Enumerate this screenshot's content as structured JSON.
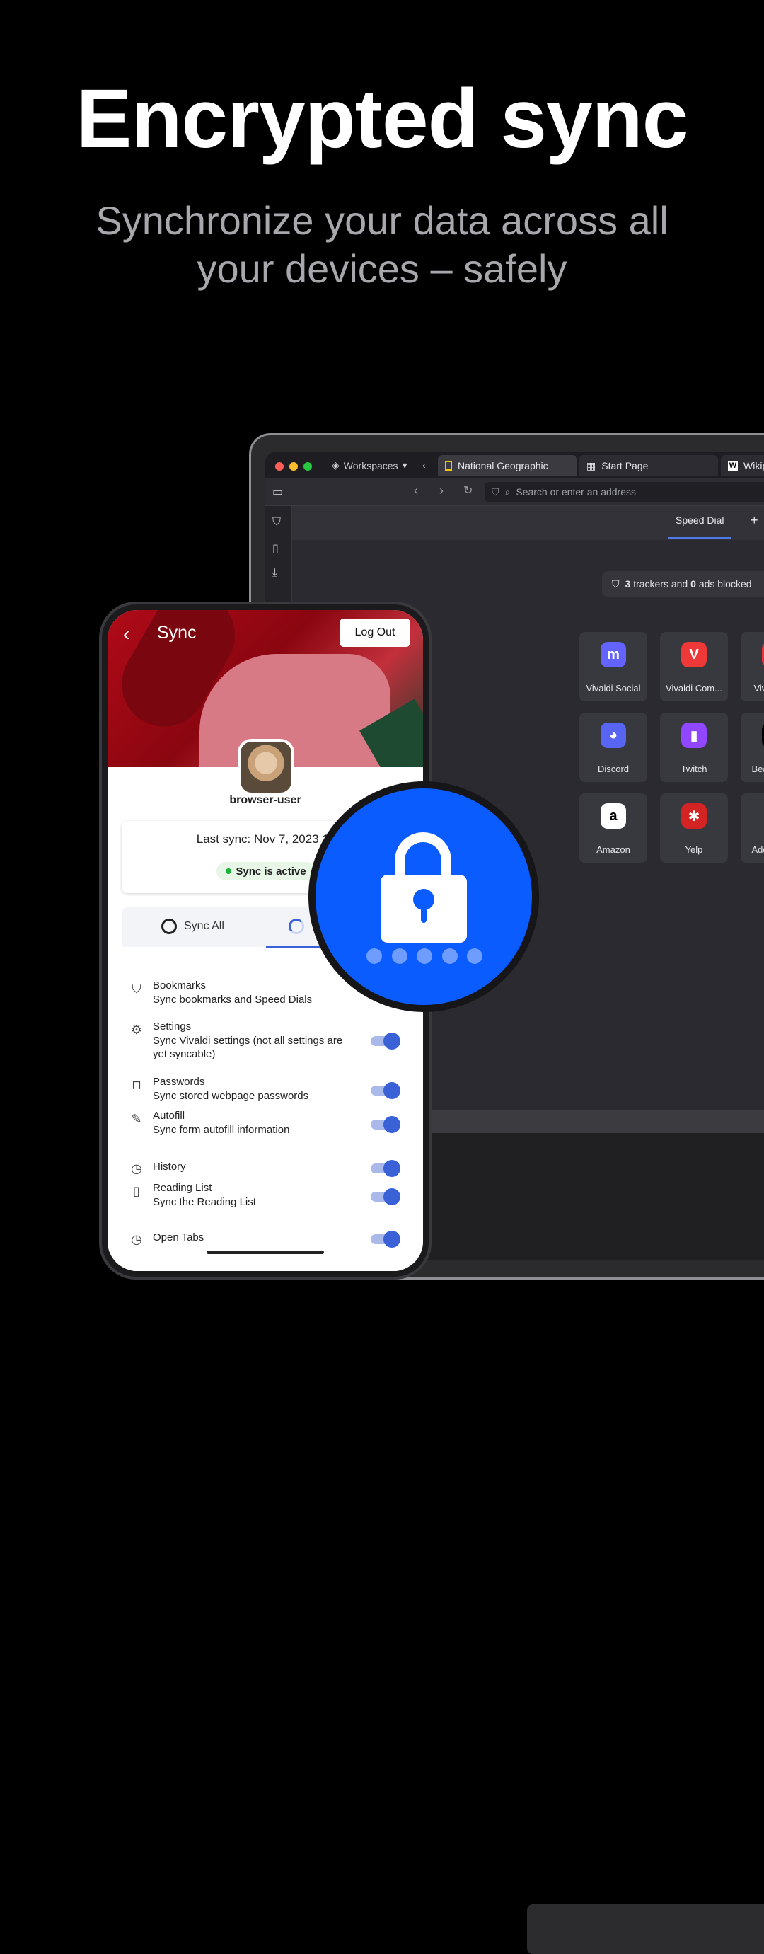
{
  "headline": "Encrypted sync",
  "subheadline": "Synchronize your data across all your devices – safely",
  "laptop": {
    "workspaces": "Workspaces",
    "tabs": [
      "National Geographic",
      "Start Page",
      "Wikiped"
    ],
    "address_placeholder": "Search or enter an address",
    "speed_dial_tab": "Speed Dial",
    "add_tab": "+",
    "tracker_count": "3",
    "tracker_text": "trackers and",
    "ads_count": "0",
    "ads_text": "ads blocked",
    "tiles": [
      {
        "label": "Vivaldi Social",
        "icon": "mastodon-icon",
        "color": "#6364ff"
      },
      {
        "label": "Vivaldi Com...",
        "icon": "vivaldi-icon",
        "color": "#ef3939"
      },
      {
        "label": "Vivaldi Ga",
        "icon": "vivaldi-game-icon",
        "color": "#e8333b"
      },
      {
        "label": "Discord",
        "icon": "discord-icon",
        "color": "#5865f2"
      },
      {
        "label": "Twitch",
        "icon": "twitch-icon",
        "color": "#9146ff"
      },
      {
        "label": "Beautiful Fi",
        "icon": "unsplash-icon",
        "color": "#000000"
      },
      {
        "label": "Amazon",
        "icon": "amazon-icon",
        "color": "#ffffff"
      },
      {
        "label": "Yelp",
        "icon": "yelp-icon",
        "color": "#d32323"
      },
      {
        "label": "Add New S",
        "icon": "plus-icon",
        "color": "#38383f"
      }
    ]
  },
  "phone": {
    "title": "Sync",
    "logout": "Log Out",
    "username": "browser-user",
    "last_sync": "Last sync: Nov 7, 2023 12",
    "status": "Sync is active",
    "tab_sync_all": "Sync All",
    "items": [
      {
        "title": "Bookmarks",
        "subtitle": "Sync bookmarks and Speed Dials",
        "icon": "bookmark-icon"
      },
      {
        "title": "Settings",
        "subtitle": "Sync Vivaldi settings (not all settings are yet syncable)",
        "icon": "gear-icon"
      },
      {
        "title": "Passwords",
        "subtitle": "Sync stored webpage passwords",
        "icon": "lock-icon"
      },
      {
        "title": "Autofill",
        "subtitle": "Sync form autofill information",
        "icon": "pencil-icon"
      },
      {
        "title": "History",
        "subtitle": "",
        "icon": "clock-icon"
      },
      {
        "title": "Reading List",
        "subtitle": "Sync the Reading List",
        "icon": "book-icon"
      },
      {
        "title": "Open Tabs",
        "subtitle": "",
        "icon": "clock-icon"
      }
    ]
  },
  "colors": {
    "accent": "#3a62d6",
    "lock": "#0a5cff",
    "active": "#1bb33a"
  }
}
